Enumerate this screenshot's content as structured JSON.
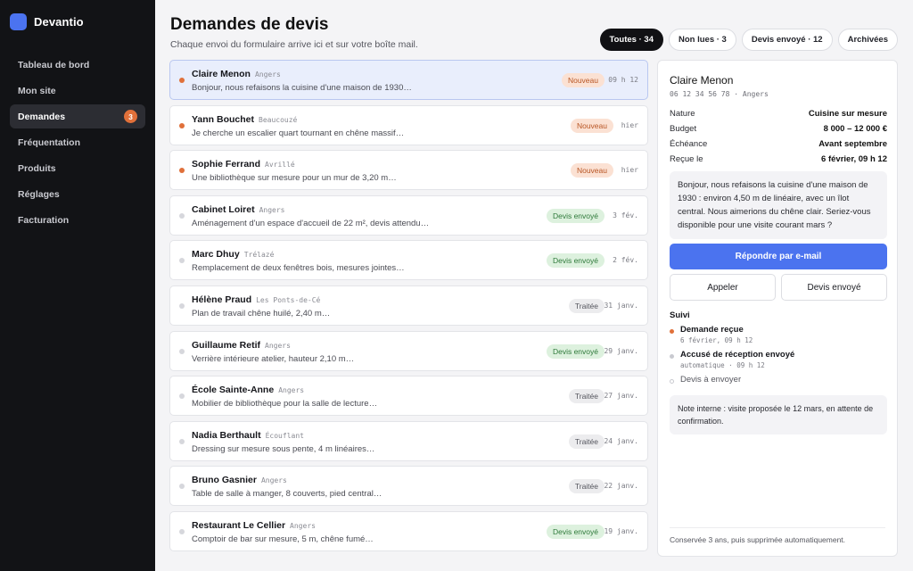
{
  "brand": {
    "name": "Devantio",
    "accent": "#4b73f0"
  },
  "sidebar": {
    "items": [
      {
        "label": "Tableau de bord",
        "active": false,
        "badge": null
      },
      {
        "label": "Mon site",
        "active": false,
        "badge": null
      },
      {
        "label": "Demandes",
        "active": true,
        "badge": "3"
      },
      {
        "label": "Fréquentation",
        "active": false,
        "badge": null
      },
      {
        "label": "Produits",
        "active": false,
        "badge": null
      },
      {
        "label": "Réglages",
        "active": false,
        "badge": null
      },
      {
        "label": "Facturation",
        "active": false,
        "badge": null
      }
    ]
  },
  "header": {
    "title": "Demandes de devis",
    "subtitle": "Chaque envoi du formulaire arrive ici et sur votre boîte mail."
  },
  "filters": [
    {
      "label": "Toutes · 34",
      "active": true
    },
    {
      "label": "Non lues · 3",
      "active": false
    },
    {
      "label": "Devis envoyé · 12",
      "active": false
    },
    {
      "label": "Archivées",
      "active": false
    }
  ],
  "requests": [
    {
      "name": "Claire Menon",
      "location": "Angers",
      "preview": "Bonjour, nous refaisons la cuisine d'une maison de 1930…",
      "status": "Nouveau",
      "status_kind": "nouveau",
      "time": "09 h 12",
      "unread": true,
      "selected": true
    },
    {
      "name": "Yann Bouchet",
      "location": "Beaucouzé",
      "preview": "Je cherche un escalier quart tournant en chêne massif…",
      "status": "Nouveau",
      "status_kind": "nouveau",
      "time": "hier",
      "unread": true,
      "selected": false
    },
    {
      "name": "Sophie Ferrand",
      "location": "Avrillé",
      "preview": "Une bibliothèque sur mesure pour un mur de 3,20 m…",
      "status": "Nouveau",
      "status_kind": "nouveau",
      "time": "hier",
      "unread": true,
      "selected": false
    },
    {
      "name": "Cabinet Loiret",
      "location": "Angers",
      "preview": "Aménagement d'un espace d'accueil de 22 m², devis attendu…",
      "status": "Devis envoyé",
      "status_kind": "devis",
      "time": "3 fév.",
      "unread": false,
      "selected": false
    },
    {
      "name": "Marc Dhuy",
      "location": "Trélazé",
      "preview": "Remplacement de deux fenêtres bois, mesures jointes…",
      "status": "Devis envoyé",
      "status_kind": "devis",
      "time": "2 fév.",
      "unread": false,
      "selected": false
    },
    {
      "name": "Hélène Praud",
      "location": "Les Ponts-de-Cé",
      "preview": "Plan de travail chêne huilé, 2,40 m…",
      "status": "Traitée",
      "status_kind": "traitee",
      "time": "31 janv.",
      "unread": false,
      "selected": false
    },
    {
      "name": "Guillaume Retif",
      "location": "Angers",
      "preview": "Verrière intérieure atelier, hauteur 2,10 m…",
      "status": "Devis envoyé",
      "status_kind": "devis",
      "time": "29 janv.",
      "unread": false,
      "selected": false
    },
    {
      "name": "École Sainte-Anne",
      "location": "Angers",
      "preview": "Mobilier de bibliothèque pour la salle de lecture…",
      "status": "Traitée",
      "status_kind": "traitee",
      "time": "27 janv.",
      "unread": false,
      "selected": false
    },
    {
      "name": "Nadia Berthault",
      "location": "Écouflant",
      "preview": "Dressing sur mesure sous pente, 4 m linéaires…",
      "status": "Traitée",
      "status_kind": "traitee",
      "time": "24 janv.",
      "unread": false,
      "selected": false
    },
    {
      "name": "Bruno Gasnier",
      "location": "Angers",
      "preview": "Table de salle à manger, 8 couverts, pied central…",
      "status": "Traitée",
      "status_kind": "traitee",
      "time": "22 janv.",
      "unread": false,
      "selected": false
    },
    {
      "name": "Restaurant Le Cellier",
      "location": "Angers",
      "preview": "Comptoir de bar sur mesure, 5 m, chêne fumé…",
      "status": "Devis envoyé",
      "status_kind": "devis",
      "time": "19 janv.",
      "unread": false,
      "selected": false
    }
  ],
  "detail": {
    "name": "Claire Menon",
    "phone_location": "06 12 34 56 78 · Angers",
    "fields": [
      {
        "key": "Nature",
        "value": "Cuisine sur mesure"
      },
      {
        "key": "Budget",
        "value": "8 000 – 12 000 €"
      },
      {
        "key": "Échéance",
        "value": "Avant septembre"
      },
      {
        "key": "Reçue le",
        "value": "6 février, 09 h 12"
      }
    ],
    "message": "Bonjour, nous refaisons la cuisine d'une maison de 1930 : environ 4,50 m de linéaire, avec un îlot central. Nous aimerions du chêne clair. Seriez-vous disponible pour une visite courant mars ?",
    "reply_label": "Répondre par e-mail",
    "call_label": "Appeler",
    "devis_label": "Devis envoyé",
    "suivi_title": "Suivi",
    "timeline": [
      {
        "label": "Demande reçue",
        "meta": "6 février, 09 h 12",
        "state": "done"
      },
      {
        "label": "Accusé de réception envoyé",
        "meta": "automatique · 09 h 12",
        "state": "sent"
      },
      {
        "label": "Devis à envoyer",
        "meta": "",
        "state": "pending"
      }
    ],
    "note": "Note interne : visite proposée le 12 mars, en attente de confirmation.",
    "footer": "Conservée 3 ans, puis supprimée automatiquement."
  }
}
